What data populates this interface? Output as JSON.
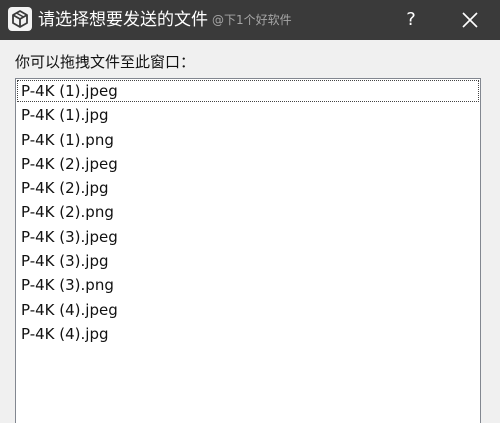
{
  "window": {
    "title": "请选择想要发送的文件",
    "watermark": "@下1个好软件",
    "help_label": "?",
    "close_icon": "close-icon",
    "app_icon": "cube-icon"
  },
  "instruction": "你可以拖拽文件至此窗口：",
  "files": [
    "P-4K (1).jpeg",
    "P-4K (1).jpg",
    "P-4K (1).png",
    "P-4K (2).jpeg",
    "P-4K (2).jpg",
    "P-4K (2).png",
    "P-4K (3).jpeg",
    "P-4K (3).jpg",
    "P-4K (3).png",
    "P-4K (4).jpeg",
    "P-4K (4).jpg"
  ],
  "colors": {
    "titlebar": "#3a3a3a",
    "background": "#f0f0f0",
    "list_background": "#ffffff",
    "list_border": "#828790"
  }
}
